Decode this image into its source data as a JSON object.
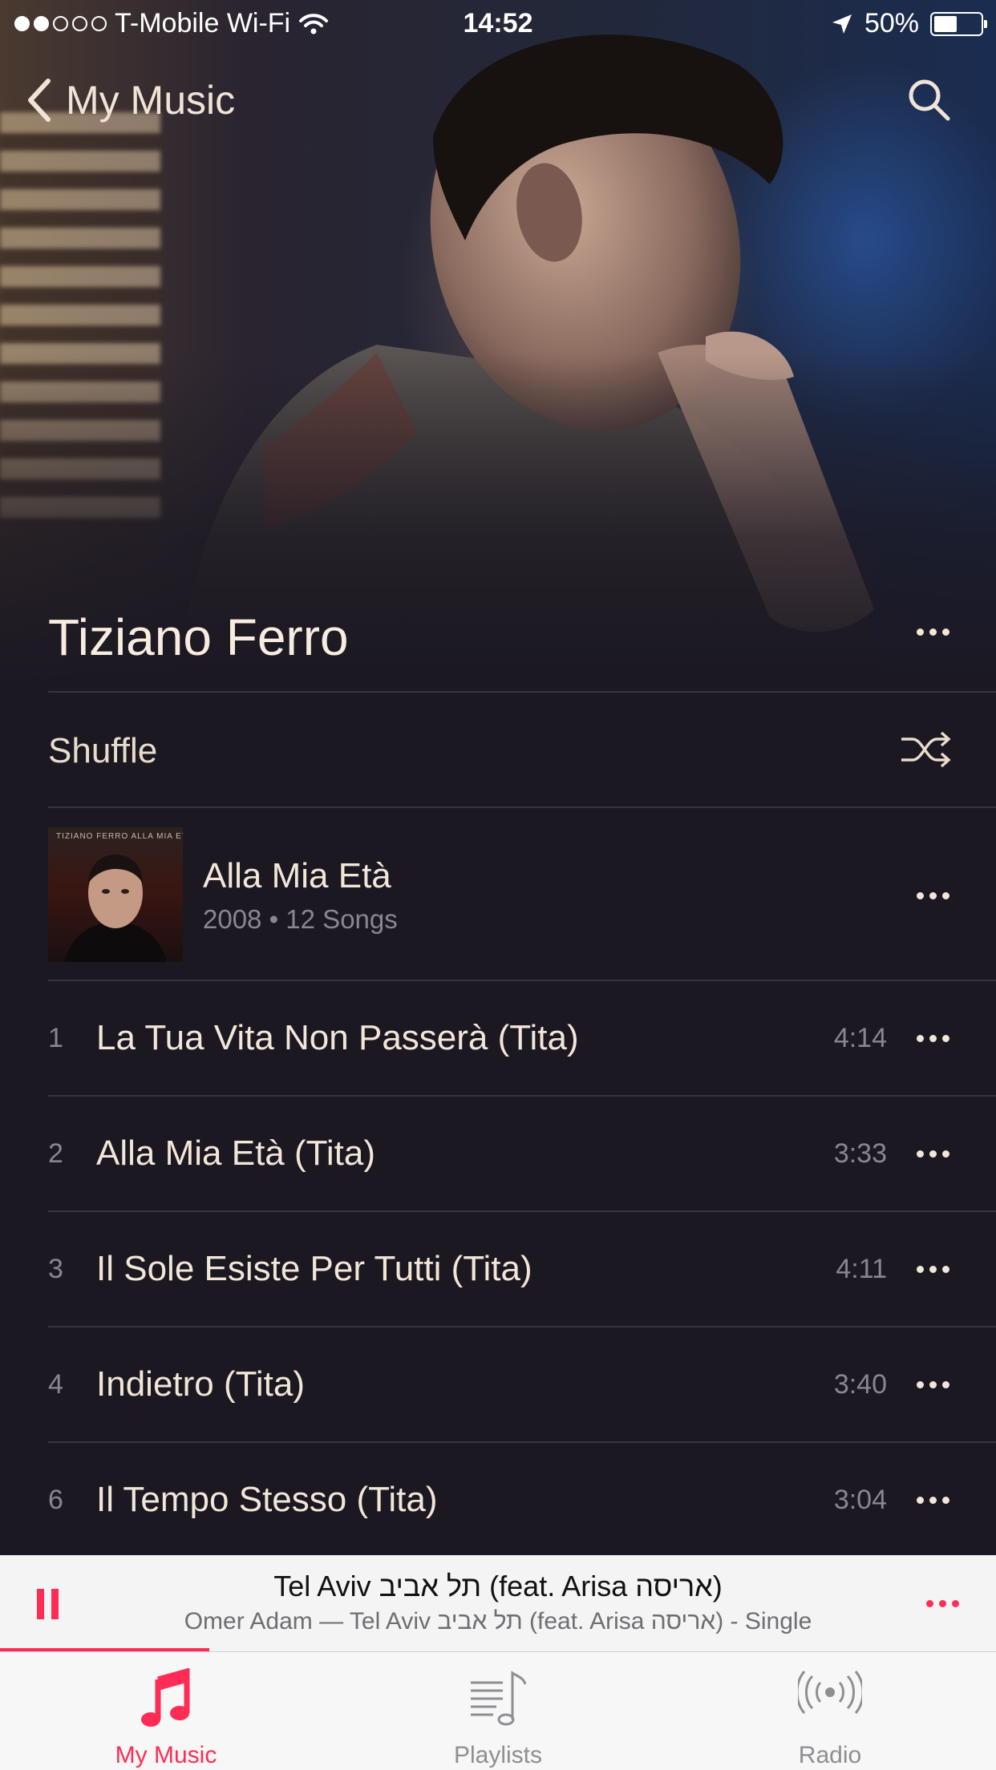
{
  "status_bar": {
    "carrier": "T-Mobile Wi-Fi",
    "time": "14:52",
    "battery": "50%",
    "battery_level": 0.5,
    "signal_bars": 2
  },
  "nav": {
    "back_label": "My Music"
  },
  "artist": {
    "name": "Tiziano Ferro"
  },
  "shuffle": {
    "label": "Shuffle"
  },
  "album": {
    "title": "Alla Mia Età",
    "subtitle": "2008 • 12 Songs",
    "cover_text": "TIZIANO FERRO ALLA MIA ETÀ"
  },
  "tracks": [
    {
      "num": "1",
      "title": "La Tua Vita Non Passerà (Tita)",
      "duration": "4:14"
    },
    {
      "num": "2",
      "title": "Alla Mia Età (Tita)",
      "duration": "3:33"
    },
    {
      "num": "3",
      "title": "Il Sole Esiste Per Tutti (Tita)",
      "duration": "4:11"
    },
    {
      "num": "4",
      "title": "Indietro (Tita)",
      "duration": "3:40"
    },
    {
      "num": "6",
      "title": "Il Tempo Stesso (Tita)",
      "duration": "3:04"
    }
  ],
  "now_playing": {
    "title": "Tel Aviv תל אביב (feat. Arisa אריסה)",
    "subtitle": "Omer Adam — Tel Aviv תל אביב (feat. Arisa אריסה) - Single",
    "progress": 0.21
  },
  "tabs": [
    {
      "label": "My Music",
      "active": true
    },
    {
      "label": "Playlists",
      "active": false
    },
    {
      "label": "Radio",
      "active": false
    }
  ],
  "colors": {
    "accent": "#ff2d55",
    "background": "#1b1822",
    "text": "#f2e6d8",
    "secondary_text": "#8c8590"
  }
}
